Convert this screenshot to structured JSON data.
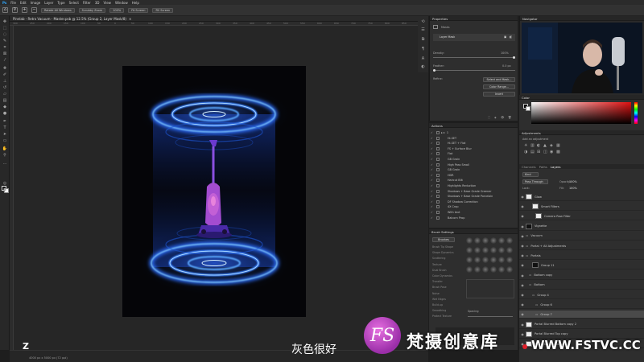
{
  "menu": [
    "Ps",
    "File",
    "Edit",
    "Image",
    "Layer",
    "Type",
    "Select",
    "Filter",
    "3D",
    "View",
    "Window",
    "Help"
  ],
  "options_bar": {
    "rotate_all_windows": "Rotate All Windows",
    "scrubby_zoom": "Scrubby Zoom",
    "zoom_level": "100%",
    "fit_screen": "Fit Screen",
    "fill_screen": "Fill Screen"
  },
  "document_tab": "Pinelab - Retro Vacuum - Master.psb @ 12.5% (Group 2, Layer Mask/8)",
  "ruler_ticks": [
    "300",
    "250",
    "200",
    "150",
    "100",
    "50",
    "0",
    "50",
    "100",
    "150",
    "200",
    "250",
    "300",
    "350",
    "400",
    "450",
    "500",
    "550",
    "600",
    "650",
    "700",
    "750",
    "800",
    "850",
    "900"
  ],
  "status_bar": "4000 px x 5000 px (72 ppi)",
  "properties": {
    "title": "Properties",
    "section": "Masks",
    "layer_mask_label": "Layer Mask",
    "density_label": "Density:",
    "density_value": "100%",
    "feather_label": "Feather:",
    "feather_value": "0.0 px",
    "refine_label": "Refine:",
    "select_mask_button": "Select and Mask...",
    "color_range_button": "Color Range...",
    "invert_button": "Invert"
  },
  "actions": {
    "title": "Actions",
    "items": [
      "1",
      "Hi-SET",
      "Hi-SET + Flat",
      "FS + Surface Blur",
      "Flat",
      "GB Grain",
      "High Pass Small",
      "GB Grain",
      "HDR",
      "Haircut Blit",
      "Highlights Reduction",
      "Shadows + Base Grade Greener",
      "Shadows + Base Grade Porcelain",
      "DF Shadow Correction",
      "4X Crop",
      "With text",
      "Balcorn Prop"
    ]
  },
  "brush_settings": {
    "title": "Brush Settings",
    "brushes_button": "Brushes",
    "options": [
      "Brush Tip Shape",
      "Shape Dynamics",
      "Scattering",
      "Texture",
      "Dual Brush",
      "Color Dynamics",
      "Transfer",
      "Brush Pose",
      "Noise",
      "Wet Edges",
      "Build-up",
      "Smoothing",
      "Protect Texture"
    ],
    "spacing_label": "Spacing"
  },
  "navigator": {
    "title": "Navigator"
  },
  "color_panel": {
    "title": "Color"
  },
  "adjustments": {
    "title": "Adjustments",
    "subtitle": "Add an adjustment"
  },
  "layers": {
    "tabs": [
      "Channels",
      "Paths",
      "Layers"
    ],
    "active_tab": "Layers",
    "kind_label": "Kind",
    "blend_mode": "Pass Through",
    "opacity_label": "Opacity:",
    "opacity_value": "100%",
    "lock_label": "Lock:",
    "fill_label": "Fill:",
    "fill_value": "100%",
    "rows": [
      "Glow",
      "Smart Filters",
      "Camera Raw Filter",
      "Vignette",
      "Vacuum",
      "Portal + All Adjustments",
      "Portals",
      "Group 11",
      "Bottom copy",
      "Bottom",
      "Group 4",
      "Group 6",
      "Group 7",
      "Portal Blurred Bottom copy 2",
      "Portal Blurred Top copy",
      "Portal Blurred Bottom"
    ],
    "selected_row": "Group 7"
  },
  "overlay": {
    "key_hint": "Z",
    "subtitle": "灰色很好",
    "watermark_logo": "FS",
    "watermark_cn": "梵摄创意库",
    "watermark_url": "WWW.FSTVC.CC"
  },
  "colors": {
    "glow": "#2a6dff",
    "accent_core": "#8fd8ff",
    "vacuum": "#b04bd8"
  }
}
